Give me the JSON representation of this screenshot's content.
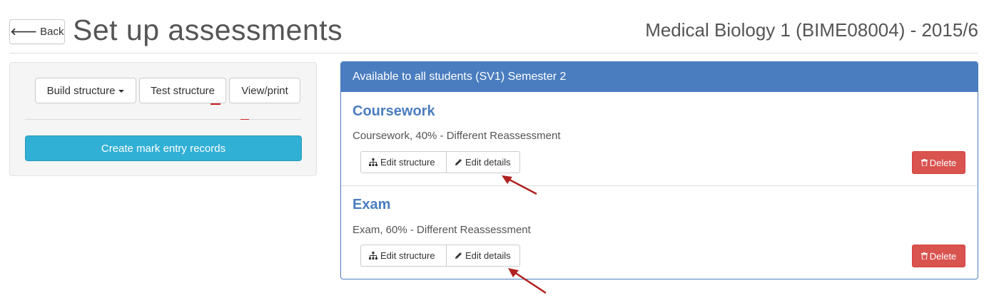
{
  "header": {
    "back_label": "Back",
    "title": "Set up assessments",
    "module": "Medical Biology 1 (BIME08004) - 2015/6"
  },
  "left_panel": {
    "build_structure": "Build structure",
    "test_structure": "Test structure",
    "view_print": "View/print",
    "create_records": "Create mark entry records"
  },
  "right_panel": {
    "heading": "Available to all students (SV1) Semester 2",
    "assessments": [
      {
        "title": "Coursework",
        "description": "Coursework, 40% - Different Reassessment",
        "edit_structure": "Edit structure",
        "edit_details": "Edit details",
        "delete": "Delete"
      },
      {
        "title": "Exam",
        "description": "Exam, 60% - Different Reassessment",
        "edit_structure": "Edit structure",
        "edit_details": "Edit details",
        "delete": "Delete"
      }
    ]
  },
  "colors": {
    "primary": "#4a7dbf",
    "info": "#31b0d5",
    "danger": "#d9534f",
    "annotation_arrow": "#b22222"
  },
  "icons": {
    "back": "arrow-left-icon",
    "structure": "sitemap-icon",
    "edit": "pencil-icon",
    "delete": "trash-icon"
  }
}
